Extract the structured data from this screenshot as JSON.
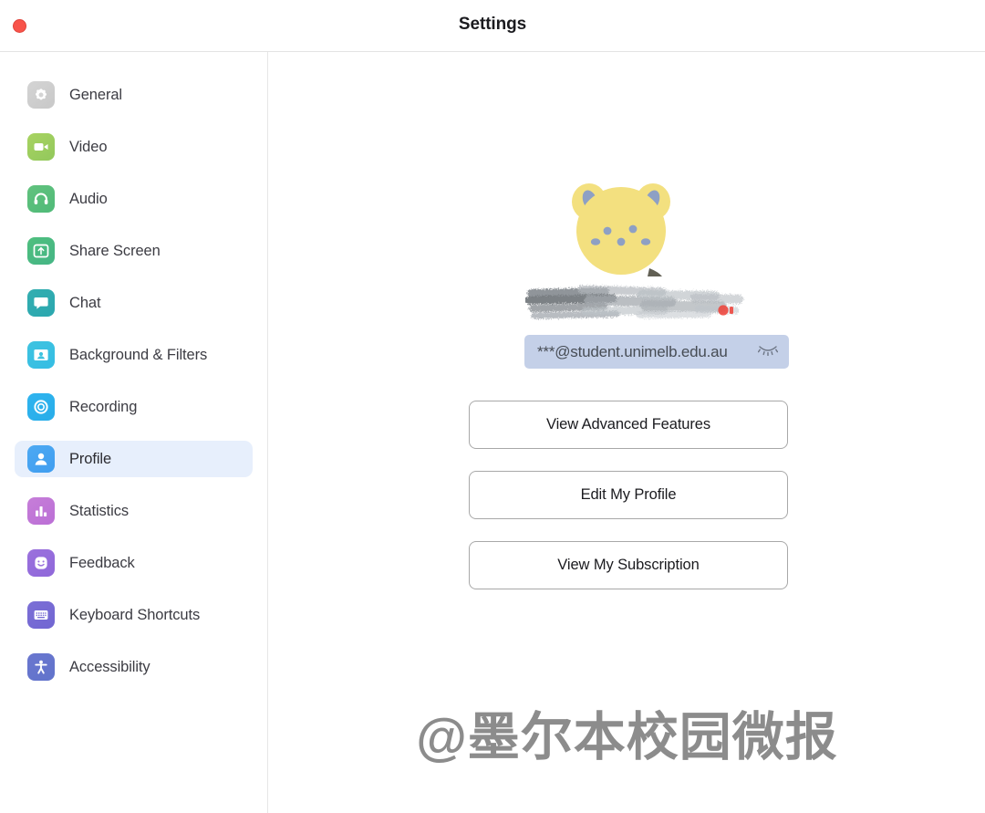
{
  "window": {
    "title": "Settings",
    "close_button": "close",
    "accent_close_color": "#f8534a"
  },
  "sidebar": {
    "items": [
      {
        "label": "General",
        "icon": "gear-icon",
        "color_from": "#d4d4d4",
        "color_to": "#c8c8c8",
        "active": false
      },
      {
        "label": "Video",
        "icon": "camera-icon",
        "color_from": "#a8d361",
        "color_to": "#92c85c",
        "active": false
      },
      {
        "label": "Audio",
        "icon": "headphones-icon",
        "color_from": "#62c27e",
        "color_to": "#4fba78",
        "active": false
      },
      {
        "label": "Share Screen",
        "icon": "share-screen-icon",
        "color_from": "#4fbf7e",
        "color_to": "#45b585",
        "active": false
      },
      {
        "label": "Chat",
        "icon": "chat-bubble-icon",
        "color_from": "#33aeb0",
        "color_to": "#2ba7af",
        "active": false
      },
      {
        "label": "Background & Filters",
        "icon": "person-frame-icon",
        "color_from": "#3fc3e0",
        "color_to": "#34bde4",
        "active": false
      },
      {
        "label": "Recording",
        "icon": "record-circle-icon",
        "color_from": "#2fb4ef",
        "color_to": "#28ade9",
        "active": false
      },
      {
        "label": "Profile",
        "icon": "person-icon",
        "color_from": "#4da9f2",
        "color_to": "#3f9df0",
        "active": true
      },
      {
        "label": "Statistics",
        "icon": "bar-chart-icon",
        "color_from": "#c67ed8",
        "color_to": "#bb6fd6",
        "active": false
      },
      {
        "label": "Feedback",
        "icon": "smiley-icon",
        "color_from": "#9b71dd",
        "color_to": "#8f68da",
        "active": false
      },
      {
        "label": "Keyboard Shortcuts",
        "icon": "keyboard-icon",
        "color_from": "#7c6fd6",
        "color_to": "#7166d2",
        "active": false
      },
      {
        "label": "Accessibility",
        "icon": "accessibility-icon",
        "color_from": "#6a77cf",
        "color_to": "#6173cb",
        "active": false
      }
    ],
    "active_highlight_color": "#e7effc"
  },
  "profile": {
    "avatar_alt": "bear-avatar",
    "avatar_colors": {
      "face": "#f3e07f",
      "ears": "#8ea0c4",
      "dots": "#8ea0c4"
    },
    "name_redacted": true,
    "email": "***@student.unimelb.edu.au",
    "email_bar_color": "#c3cfe8",
    "email_visibility_icon": "eye-off-icon"
  },
  "actions": {
    "buttons": [
      {
        "label": "View Advanced Features"
      },
      {
        "label": "Edit My Profile"
      },
      {
        "label": "View My Subscription"
      }
    ]
  },
  "watermark": {
    "text": "@墨尔本校园微报"
  }
}
